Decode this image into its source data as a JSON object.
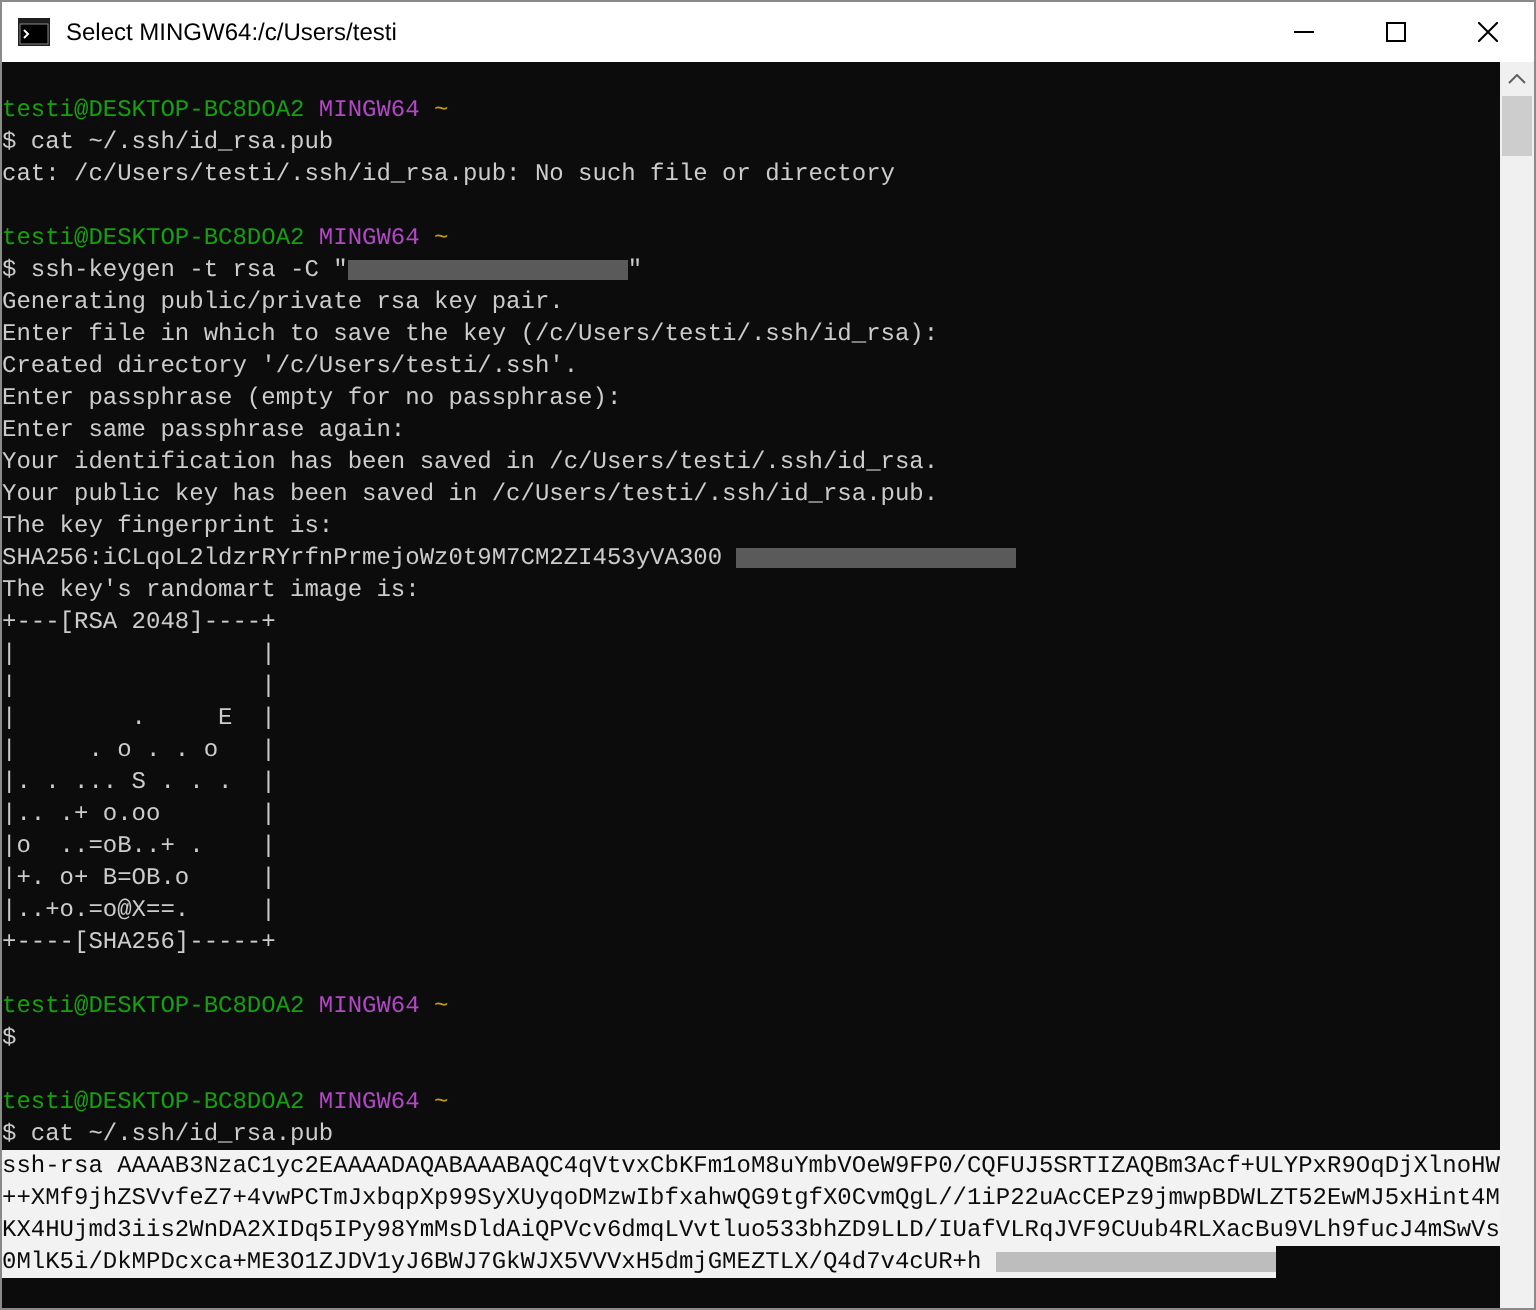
{
  "window": {
    "title": "Select MINGW64:/c/Users/testi"
  },
  "lines": [
    {
      "kind": "prompt",
      "user": "testi@DESKTOP-BC8DOA2",
      "shell": "MINGW64",
      "path": "~"
    },
    {
      "kind": "text",
      "text": "$ cat ~/.ssh/id_rsa.pub"
    },
    {
      "kind": "text",
      "text": "cat: /c/Users/testi/.ssh/id_rsa.pub: No such file or directory"
    },
    {
      "kind": "blank"
    },
    {
      "kind": "prompt",
      "user": "testi@DESKTOP-BC8DOA2",
      "shell": "MINGW64",
      "path": "~"
    },
    {
      "kind": "text",
      "text": "$ ssh-keygen -t rsa -C \"",
      "redacted": true,
      "suffix": "\""
    },
    {
      "kind": "text",
      "text": "Generating public/private rsa key pair."
    },
    {
      "kind": "text",
      "text": "Enter file in which to save the key (/c/Users/testi/.ssh/id_rsa):"
    },
    {
      "kind": "text",
      "text": "Created directory '/c/Users/testi/.ssh'."
    },
    {
      "kind": "text",
      "text": "Enter passphrase (empty for no passphrase):"
    },
    {
      "kind": "text",
      "text": "Enter same passphrase again:"
    },
    {
      "kind": "text",
      "text": "Your identification has been saved in /c/Users/testi/.ssh/id_rsa."
    },
    {
      "kind": "text",
      "text": "Your public key has been saved in /c/Users/testi/.ssh/id_rsa.pub."
    },
    {
      "kind": "text",
      "text": "The key fingerprint is:"
    },
    {
      "kind": "text",
      "text": "SHA256:iCLqoL2ldzrRYrfnPrmejoWz0t9M7CM2ZI453yVA300 ",
      "redacted": true
    },
    {
      "kind": "text",
      "text": "The key's randomart image is:"
    },
    {
      "kind": "text",
      "text": "+---[RSA 2048]----+"
    },
    {
      "kind": "text",
      "text": "|                 |"
    },
    {
      "kind": "text",
      "text": "|                 |"
    },
    {
      "kind": "text",
      "text": "|        .     E  |"
    },
    {
      "kind": "text",
      "text": "|     . o . . o   |"
    },
    {
      "kind": "text",
      "text": "|. . ... S . . .  |"
    },
    {
      "kind": "text",
      "text": "|.. .+ o.oo       |"
    },
    {
      "kind": "text",
      "text": "|o  ..=oB..+ .    |"
    },
    {
      "kind": "text",
      "text": "|+. o+ B=OB.o     |"
    },
    {
      "kind": "text",
      "text": "|..+o.=o@X==.     |"
    },
    {
      "kind": "text",
      "text": "+----[SHA256]-----+"
    },
    {
      "kind": "blank"
    },
    {
      "kind": "prompt",
      "user": "testi@DESKTOP-BC8DOA2",
      "shell": "MINGW64",
      "path": "~"
    },
    {
      "kind": "text",
      "text": "$"
    },
    {
      "kind": "blank"
    },
    {
      "kind": "prompt",
      "user": "testi@DESKTOP-BC8DOA2",
      "shell": "MINGW64",
      "path": "~"
    },
    {
      "kind": "text",
      "text": "$ cat ~/.ssh/id_rsa.pub"
    },
    {
      "kind": "selected",
      "text": "ssh-rsa AAAAB3NzaC1yc2EAAAADAQABAAABAQC4qVtvxCbKFm1oM8uYmbVOeW9FP0/CQFUJ5SRTIZAQBm3Acf+ULYPxR9OqDjXlnoHW"
    },
    {
      "kind": "selected",
      "text": "++XMf9jhZSVvfeZ7+4vwPCTmJxbqpXp99SyXUyqoDMzwIbfxahwQG9tgfX0CvmQgL//1iP22uAcCEPz9jmwpBDWLZT52EwMJ5xHint4M"
    },
    {
      "kind": "selected",
      "text": "KX4HUjmd3iis2WnDA2XIDq5IPy98YmMsDldAiQPVcv6dmqLVvtluo533bhZD9LLD/IUafVLRqJVF9CUub4RLXacBu9VLh9fucJ4mSwVs"
    },
    {
      "kind": "selected",
      "text": "0MlK5i/DkMPDcxca+ME3O1ZJDV1yJ6BWJ7GkWJX5VVVxH5dmjGMEZTLX/Q4d7v4cUR+h ",
      "redacted": true
    }
  ]
}
